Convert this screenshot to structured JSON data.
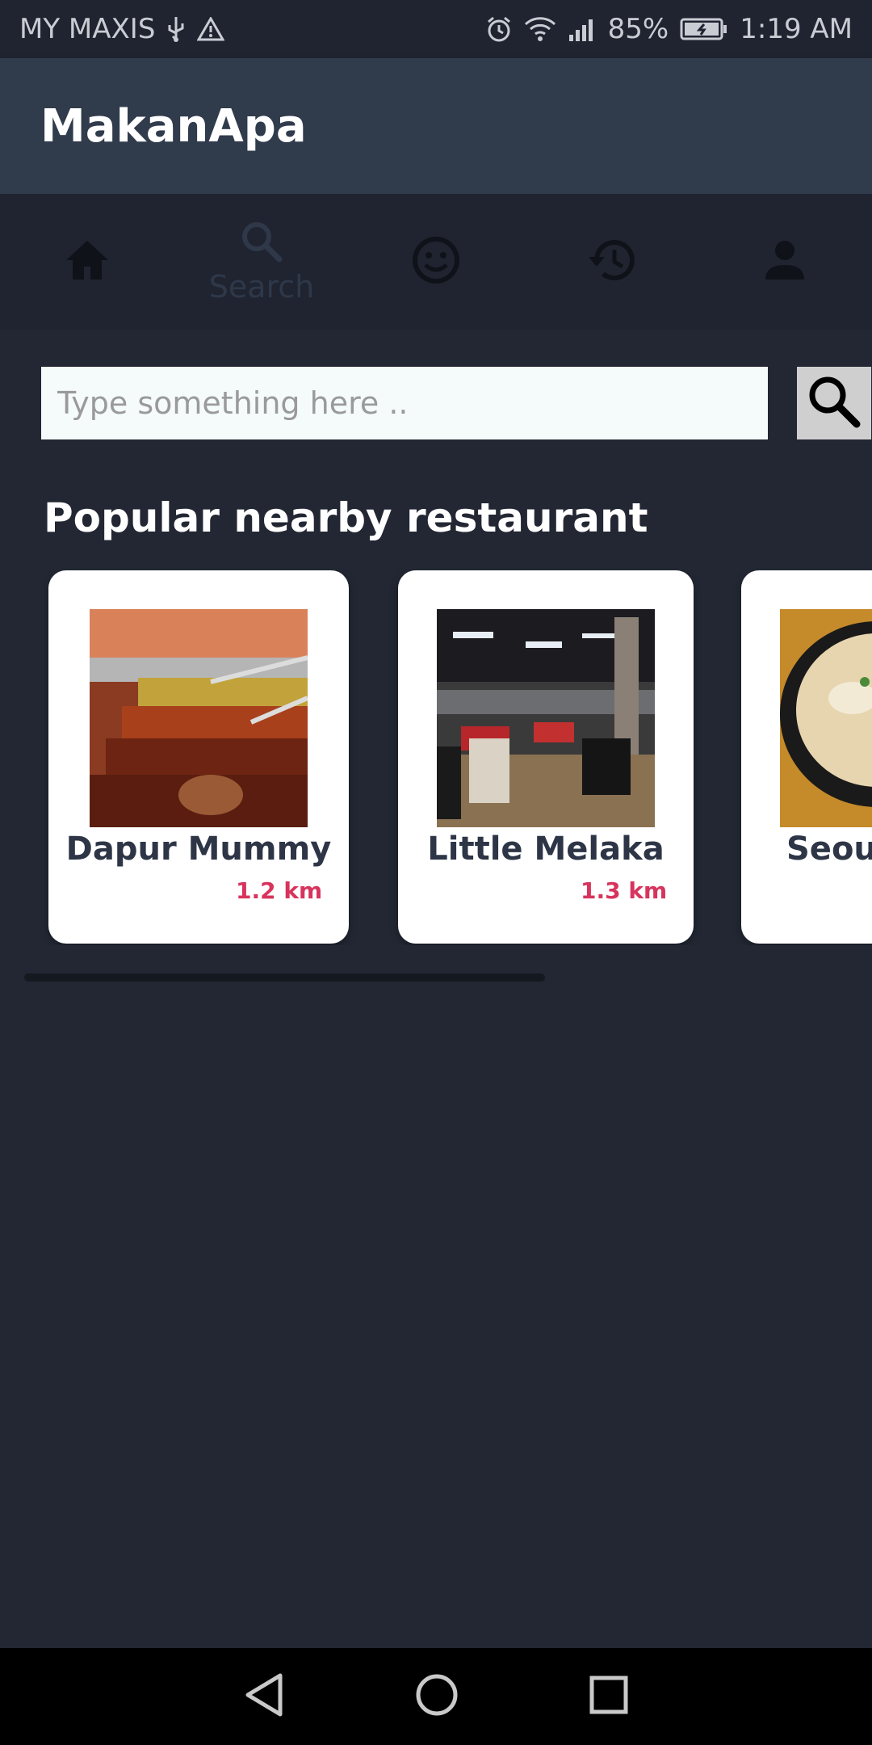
{
  "status_bar": {
    "carrier": "MY MAXIS",
    "battery": "85%",
    "time": "1:19 AM",
    "icons": [
      "usb-icon",
      "warning-icon",
      "alarm-icon",
      "wifi-icon",
      "signal-icon",
      "battery-icon"
    ]
  },
  "app_bar": {
    "title": "MakanApa"
  },
  "tabs": [
    {
      "name": "home",
      "icon": "home-icon",
      "label": ""
    },
    {
      "name": "search",
      "icon": "search-icon",
      "label": "Search"
    },
    {
      "name": "mood",
      "icon": "smiley-icon",
      "label": ""
    },
    {
      "name": "history",
      "icon": "history-icon",
      "label": ""
    },
    {
      "name": "profile",
      "icon": "person-icon",
      "label": ""
    }
  ],
  "search": {
    "placeholder": "Type something here ..",
    "value": ""
  },
  "section": {
    "title": "Popular nearby restaurant"
  },
  "restaurants": [
    {
      "name": "Dapur Mummy",
      "distance": "1.2 km"
    },
    {
      "name": "Little Melaka",
      "distance": "1.3 km"
    },
    {
      "name": "Seoul",
      "distance": ""
    }
  ],
  "colors": {
    "background": "#222733",
    "app_bar": "#303b4c",
    "accent_distance": "#d7345d"
  }
}
